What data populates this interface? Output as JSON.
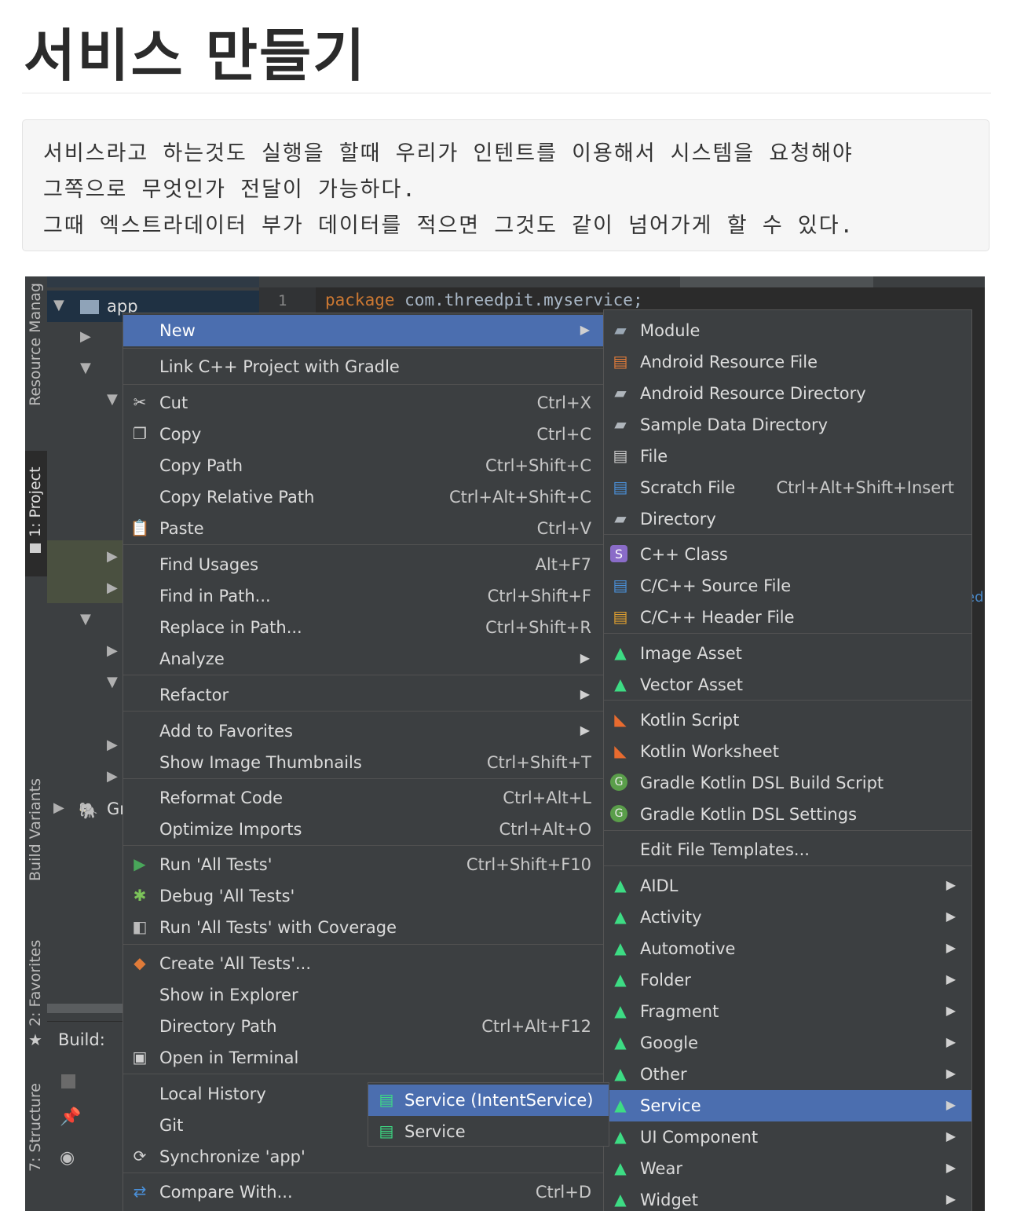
{
  "page": {
    "title": "서비스 만들기",
    "note_lines": [
      "서비스라고 하는것도 실행을 할때 우리가 인텐트를 이용해서 시스템을 요청해야",
      "그쪽으로 무엇인가 전달이 가능하다.",
      "그때 엑스트라데이터 부가 데이터를 적으면 그것도 같이 넘어가게 할 수 있다."
    ]
  },
  "ide": {
    "toolstrip": {
      "resource_manager": "Resource Manag",
      "project": "1: Project",
      "build_variants": "Build Variants",
      "favorites": "2: Favorites",
      "structure": "7: Structure"
    },
    "tree": {
      "app": "app",
      "gradle_partial": "Gr",
      "build_label": "Build:"
    },
    "editor": {
      "line_number": "1",
      "code_keyword": "package",
      "code_rest": " com.threedpit.myservice;",
      "edge_text": "ed"
    },
    "context_menu": {
      "items": [
        {
          "label": "New",
          "shortcut": "",
          "submenu": true,
          "icon": "",
          "selected": true
        },
        {
          "label": "Link C++ Project with Gradle",
          "shortcut": "",
          "submenu": false,
          "icon": ""
        },
        {
          "label": "Cut",
          "shortcut": "Ctrl+X",
          "submenu": false,
          "icon": "scissors-icon"
        },
        {
          "label": "Copy",
          "shortcut": "Ctrl+C",
          "submenu": false,
          "icon": "copy-icon"
        },
        {
          "label": "Copy Path",
          "shortcut": "Ctrl+Shift+C",
          "submenu": false,
          "icon": ""
        },
        {
          "label": "Copy Relative Path",
          "shortcut": "Ctrl+Alt+Shift+C",
          "submenu": false,
          "icon": ""
        },
        {
          "label": "Paste",
          "shortcut": "Ctrl+V",
          "submenu": false,
          "icon": "paste-icon"
        },
        {
          "label": "Find Usages",
          "shortcut": "Alt+F7",
          "submenu": false,
          "icon": ""
        },
        {
          "label": "Find in Path...",
          "shortcut": "Ctrl+Shift+F",
          "submenu": false,
          "icon": ""
        },
        {
          "label": "Replace in Path...",
          "shortcut": "Ctrl+Shift+R",
          "submenu": false,
          "icon": ""
        },
        {
          "label": "Analyze",
          "shortcut": "",
          "submenu": true,
          "icon": ""
        },
        {
          "label": "Refactor",
          "shortcut": "",
          "submenu": true,
          "icon": ""
        },
        {
          "label": "Add to Favorites",
          "shortcut": "",
          "submenu": true,
          "icon": ""
        },
        {
          "label": "Show Image Thumbnails",
          "shortcut": "Ctrl+Shift+T",
          "submenu": false,
          "icon": ""
        },
        {
          "label": "Reformat Code",
          "shortcut": "Ctrl+Alt+L",
          "submenu": false,
          "icon": ""
        },
        {
          "label": "Optimize Imports",
          "shortcut": "Ctrl+Alt+O",
          "submenu": false,
          "icon": ""
        },
        {
          "label": "Run 'All Tests'",
          "shortcut": "Ctrl+Shift+F10",
          "submenu": false,
          "icon": "run-icon"
        },
        {
          "label": "Debug 'All Tests'",
          "shortcut": "",
          "submenu": false,
          "icon": "debug-icon"
        },
        {
          "label": "Run 'All Tests' with Coverage",
          "shortcut": "",
          "submenu": false,
          "icon": "coverage-icon"
        },
        {
          "label": "Create 'All Tests'...",
          "shortcut": "",
          "submenu": false,
          "icon": "create-test-icon"
        },
        {
          "label": "Show in Explorer",
          "shortcut": "",
          "submenu": false,
          "icon": ""
        },
        {
          "label": "Directory Path",
          "shortcut": "Ctrl+Alt+F12",
          "submenu": false,
          "icon": ""
        },
        {
          "label": "Open in Terminal",
          "shortcut": "",
          "submenu": false,
          "icon": "terminal-icon"
        },
        {
          "label": "Local History",
          "shortcut": "",
          "submenu": false,
          "icon": ""
        },
        {
          "label": "Git",
          "shortcut": "",
          "submenu": false,
          "icon": ""
        },
        {
          "label": "Synchronize 'app'",
          "shortcut": "",
          "submenu": false,
          "icon": "sync-icon"
        },
        {
          "label": "Compare With...",
          "shortcut": "Ctrl+D",
          "submenu": false,
          "icon": "compare-icon"
        }
      ]
    },
    "new_submenu": {
      "items": [
        {
          "label": "Module",
          "shortcut": "",
          "submenu": false,
          "icon": "module-icon"
        },
        {
          "label": "Android Resource File",
          "shortcut": "",
          "submenu": false,
          "icon": "resource-file-icon"
        },
        {
          "label": "Android Resource Directory",
          "shortcut": "",
          "submenu": false,
          "icon": "folder-icon"
        },
        {
          "label": "Sample Data Directory",
          "shortcut": "",
          "submenu": false,
          "icon": "folder-icon"
        },
        {
          "label": "File",
          "shortcut": "",
          "submenu": false,
          "icon": "file-icon"
        },
        {
          "label": "Scratch File",
          "shortcut": "Ctrl+Alt+Shift+Insert",
          "submenu": false,
          "icon": "scratch-file-icon"
        },
        {
          "label": "Directory",
          "shortcut": "",
          "submenu": false,
          "icon": "folder-icon"
        },
        {
          "label": "C++ Class",
          "shortcut": "",
          "submenu": false,
          "icon": "cpp-class-icon"
        },
        {
          "label": "C/C++ Source File",
          "shortcut": "",
          "submenu": false,
          "icon": "cpp-source-icon"
        },
        {
          "label": "C/C++ Header File",
          "shortcut": "",
          "submenu": false,
          "icon": "cpp-header-icon"
        },
        {
          "label": "Image Asset",
          "shortcut": "",
          "submenu": false,
          "icon": "android-icon"
        },
        {
          "label": "Vector Asset",
          "shortcut": "",
          "submenu": false,
          "icon": "android-icon"
        },
        {
          "label": "Kotlin Script",
          "shortcut": "",
          "submenu": false,
          "icon": "kotlin-icon"
        },
        {
          "label": "Kotlin Worksheet",
          "shortcut": "",
          "submenu": false,
          "icon": "kotlin-icon"
        },
        {
          "label": "Gradle Kotlin DSL Build Script",
          "shortcut": "",
          "submenu": false,
          "icon": "gradle-icon"
        },
        {
          "label": "Gradle Kotlin DSL Settings",
          "shortcut": "",
          "submenu": false,
          "icon": "gradle-icon"
        },
        {
          "label": "Edit File Templates...",
          "shortcut": "",
          "submenu": false,
          "icon": ""
        },
        {
          "label": "AIDL",
          "shortcut": "",
          "submenu": true,
          "icon": "android-icon"
        },
        {
          "label": "Activity",
          "shortcut": "",
          "submenu": true,
          "icon": "android-icon"
        },
        {
          "label": "Automotive",
          "shortcut": "",
          "submenu": true,
          "icon": "android-icon"
        },
        {
          "label": "Folder",
          "shortcut": "",
          "submenu": true,
          "icon": "android-icon"
        },
        {
          "label": "Fragment",
          "shortcut": "",
          "submenu": true,
          "icon": "android-icon"
        },
        {
          "label": "Google",
          "shortcut": "",
          "submenu": true,
          "icon": "android-icon"
        },
        {
          "label": "Other",
          "shortcut": "",
          "submenu": true,
          "icon": "android-icon"
        },
        {
          "label": "Service",
          "shortcut": "",
          "submenu": true,
          "icon": "android-icon",
          "selected": true
        },
        {
          "label": "UI Component",
          "shortcut": "",
          "submenu": true,
          "icon": "android-icon"
        },
        {
          "label": "Wear",
          "shortcut": "",
          "submenu": true,
          "icon": "android-icon"
        },
        {
          "label": "Widget",
          "shortcut": "",
          "submenu": true,
          "icon": "android-icon"
        }
      ]
    },
    "service_submenu": {
      "items": [
        {
          "label": "Service (IntentService)",
          "shortcut": "",
          "submenu": false,
          "icon": "service-file-icon",
          "selected": true
        },
        {
          "label": "Service",
          "shortcut": "",
          "submenu": false,
          "icon": "service-file-icon"
        }
      ]
    },
    "colors": {
      "menu_bg": "#3c3f41",
      "selection": "#4b6eaf",
      "android_green": "#3ddc84",
      "keyword": "#cc7832"
    }
  }
}
